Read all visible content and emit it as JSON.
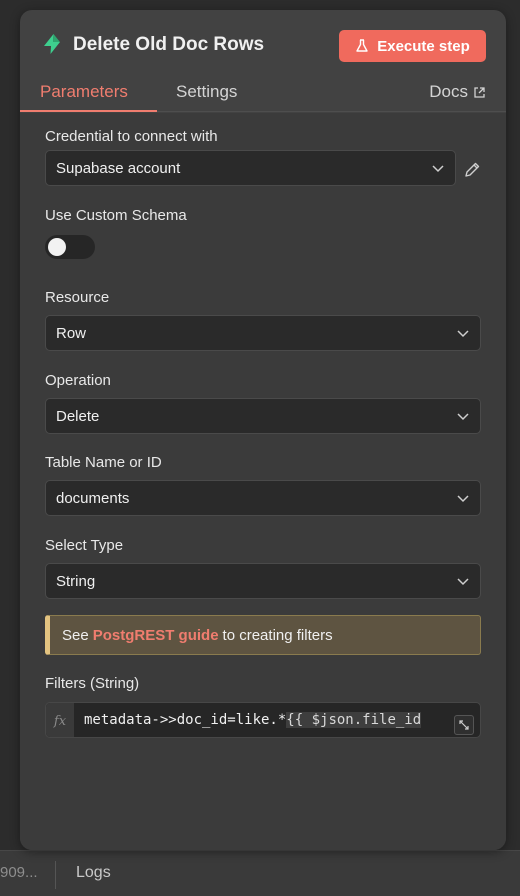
{
  "node": {
    "title": "Delete Old Doc Rows",
    "icon": "supabase-icon",
    "execute_label": "Execute step"
  },
  "tabs": {
    "parameters": "Parameters",
    "settings": "Settings",
    "docs": "Docs"
  },
  "fields": {
    "credential": {
      "label": "Credential to connect with",
      "value": "Supabase account"
    },
    "custom_schema": {
      "label": "Use Custom Schema",
      "enabled": false
    },
    "resource": {
      "label": "Resource",
      "value": "Row"
    },
    "operation": {
      "label": "Operation",
      "value": "Delete"
    },
    "table": {
      "label": "Table Name or ID",
      "value": "documents"
    },
    "select_type": {
      "label": "Select Type",
      "value": "String"
    },
    "notice": {
      "prefix": "See",
      "link": "PostgREST guide",
      "suffix": "to creating filters"
    },
    "filters": {
      "label": "Filters (String)",
      "fx": "fx",
      "code_static": "metadata->>doc_id=like.*",
      "code_expr": "{{ $json.file_id"
    }
  },
  "bottom_bar": {
    "truncated": "909...",
    "logs": "Logs"
  },
  "colors": {
    "accent": "#f06a5d",
    "brand": "#3ecf8e",
    "notice_border": "#e3c380"
  }
}
